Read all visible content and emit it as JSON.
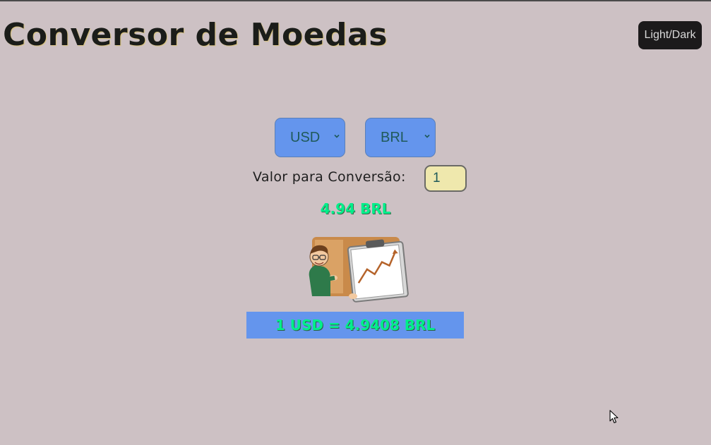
{
  "header": {
    "title": "Conversor de Moedas",
    "theme_toggle_label": "Light/Dark"
  },
  "converter": {
    "from_currency": "USD",
    "to_currency": "BRL",
    "amount_label": "Valor para Conversão:",
    "amount_value": "1",
    "result": "4.94 BRL",
    "rate_text": "1 USD = 4.9408 BRL"
  },
  "icons": {
    "select_arrow": "chevron-down-icon",
    "illustration": "analyst-chart-illustration",
    "cursor": "mouse-pointer-icon"
  },
  "colors": {
    "background": "#cdc1c4",
    "accent_blue": "#6495ed",
    "result_green": "#00ef8a",
    "input_bg": "#efe8ad",
    "toggle_bg": "#1c1a1b"
  }
}
